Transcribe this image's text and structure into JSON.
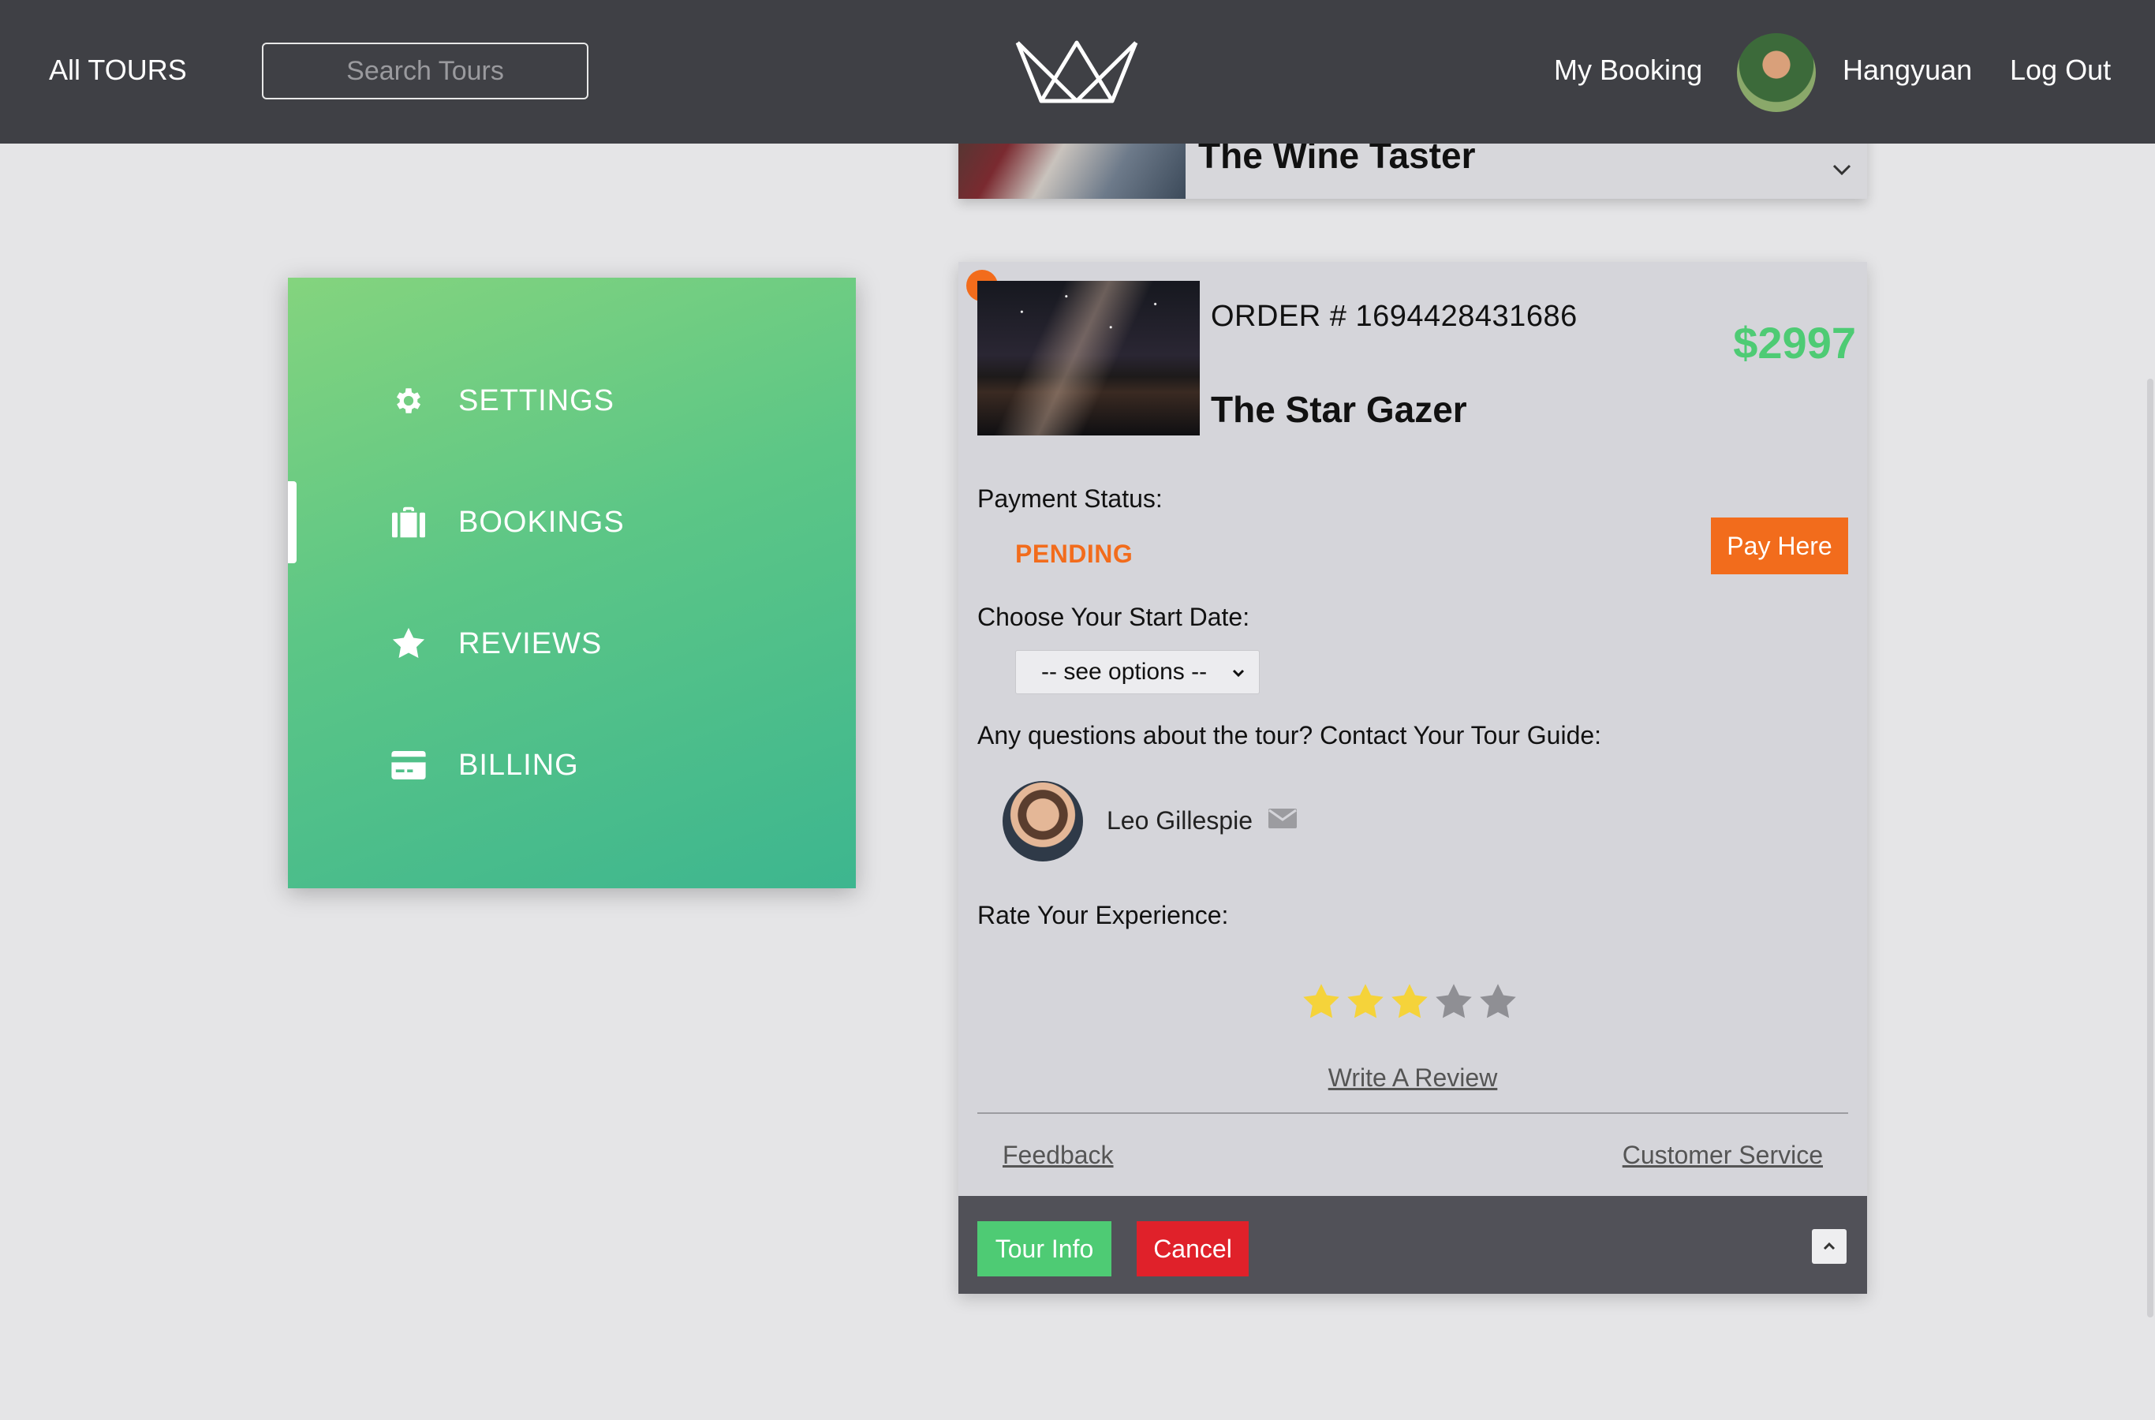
{
  "header": {
    "all_tours": "All TOURS",
    "search_placeholder": "Search Tours",
    "logo_icon": "crown-logo-icon",
    "my_booking": "My Booking",
    "user_name": "Hangyuan",
    "log_out": "Log Out"
  },
  "sidebar": {
    "items": [
      {
        "label": "SETTINGS",
        "icon": "gear-icon"
      },
      {
        "label": "BOOKINGS",
        "icon": "briefcase-icon",
        "active": true
      },
      {
        "label": "REVIEWS",
        "icon": "star-icon"
      },
      {
        "label": "BILLING",
        "icon": "credit-card-icon"
      }
    ]
  },
  "collapsed_booking": {
    "title": "The Wine Taster"
  },
  "booking": {
    "order_label": "ORDER # 1694428431686",
    "price": "$2997",
    "tour_name": "The Star Gazer",
    "payment_status_label": "Payment Status:",
    "payment_status": "PENDING",
    "pay_button": "Pay Here",
    "start_date_label": "Choose Your Start Date:",
    "start_date_select": "-- see options --",
    "questions_label": "Any questions about the tour? Contact Your Tour Guide:",
    "guide_name": "Leo Gillespie",
    "rate_label": "Rate Your Experience:",
    "rating": 3,
    "rating_max": 5,
    "write_review": "Write A Review",
    "feedback": "Feedback",
    "customer_service": "Customer Service",
    "tour_info_button": "Tour Info",
    "cancel_button": "Cancel"
  },
  "colors": {
    "topbar": "#3f4045",
    "accent_green": "#4ecb74",
    "pending_orange": "#f26c1c",
    "cancel_red": "#e0212a",
    "star_filled": "#f5d33a",
    "star_empty": "#8f8f94"
  }
}
